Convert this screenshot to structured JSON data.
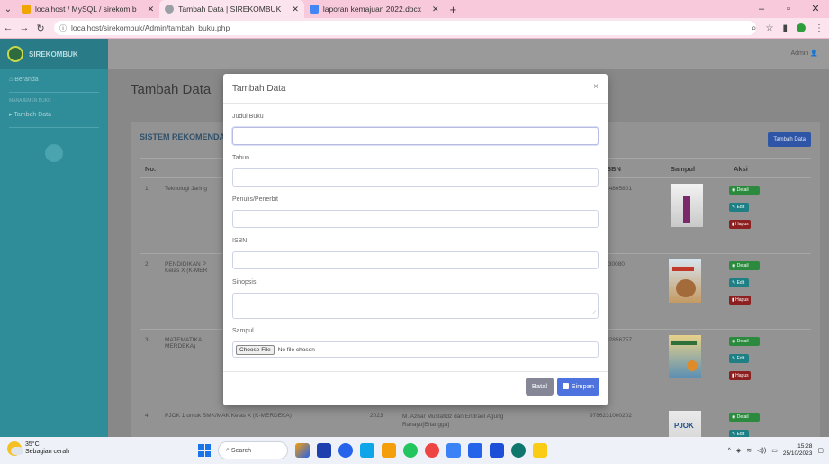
{
  "browser": {
    "tabs": [
      {
        "title": "localhost / MySQL / sirekom b",
        "active": false,
        "color": "#f0a500"
      },
      {
        "title": "Tambah Data | SIREKOMBUK",
        "active": true,
        "color": "#9aa0a6"
      },
      {
        "title": "laporan kemajuan 2022.docx",
        "active": false,
        "color": "#4285f4"
      }
    ],
    "url": "localhost/sirekombuk/Admin/tambah_buku.php"
  },
  "sidebar": {
    "brand": "SIREKOMBUK",
    "items": [
      {
        "label": "Beranda"
      },
      {
        "label": "Tambah Data"
      }
    ],
    "section_heading": "MANAJEMEN BUKU"
  },
  "topbar": {
    "user": "Admin"
  },
  "main": {
    "page_title": "Tambah Data",
    "card_title": "SISTEM REKOMENDASI",
    "add_button": "Tambah Data",
    "columns": [
      "No.",
      "",
      "",
      "",
      "ISBN",
      "Sampul",
      "Aksi"
    ],
    "rows": [
      {
        "no": "1",
        "title": "Teknologi Jaring",
        "year": "",
        "author": "",
        "isbn": "9786024865801"
      },
      {
        "no": "2",
        "title": "PENDIDIKAN P\nKelas X (K-MER",
        "year": "",
        "author": "",
        "isbn": "33730080"
      },
      {
        "no": "3",
        "title": "MATEMATIKA\nMERDEKA)",
        "year": "",
        "author": "",
        "isbn": "9786232856757"
      },
      {
        "no": "4",
        "title": "PJOK 1 untuk SMK/MAK Kelas X (K-MERDEKA)",
        "year": "2023",
        "author": "M. Azhar Mustafidz dan Endrael Agung\nRahayu[Erlangga]",
        "isbn": "9786231000202"
      }
    ],
    "actions": {
      "detail": "Detail",
      "edit": "Edit",
      "delete": "Hapus"
    }
  },
  "modal": {
    "title": "Tambah Data",
    "close": "×",
    "fields": {
      "judul": "Judul Buku",
      "tahun": "Tahun",
      "penulis": "Penulis/Penerbit",
      "isbn": "ISBN",
      "sinopsis": "Sinopsis",
      "sampul": "Sampul"
    },
    "file_button": "Choose File",
    "file_status": "No file chosen",
    "cancel_button": "Batal",
    "save_button": "Simpan"
  },
  "taskbar": {
    "weather_temp": "35°C",
    "weather_desc": "Sebagian cerah",
    "search": "Search",
    "time": "15:28",
    "date": "25/10/2023"
  }
}
